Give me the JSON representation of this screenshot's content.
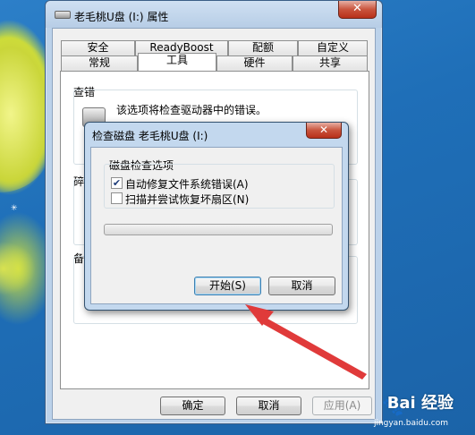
{
  "window": {
    "title": "老毛桃U盘 (I:) 属性",
    "close_symbol": "✕",
    "tabs_row1": [
      "安全",
      "ReadyBoost",
      "配额",
      "自定义"
    ],
    "tabs_row2": [
      "常规",
      "工具",
      "硬件",
      "共享"
    ],
    "active_tab": "工具",
    "error_check": {
      "group_label": "查错",
      "description": "该选项将检查驱动器中的错误。"
    },
    "partial_label_2": "碎",
    "partial_label_3": "备",
    "buttons": {
      "ok": "确定",
      "cancel": "取消",
      "apply": "应用(A)"
    }
  },
  "dialog": {
    "title": "检查磁盘 老毛桃U盘 (I:)",
    "close_symbol": "✕",
    "group_label": "磁盘检查选项",
    "options": [
      {
        "label": "自动修复文件系统错误(A)",
        "checked": true,
        "mark": "✔"
      },
      {
        "label": "扫描并尝试恢复坏扇区(N)",
        "checked": false,
        "mark": ""
      }
    ],
    "progress": 0,
    "buttons": {
      "start": "开始(S)",
      "cancel": "取消"
    }
  },
  "watermark": {
    "text": "Bai 经验",
    "url": "jingyan.baidu.com"
  },
  "colors": {
    "annotation_arrow": "#e03a3a"
  }
}
